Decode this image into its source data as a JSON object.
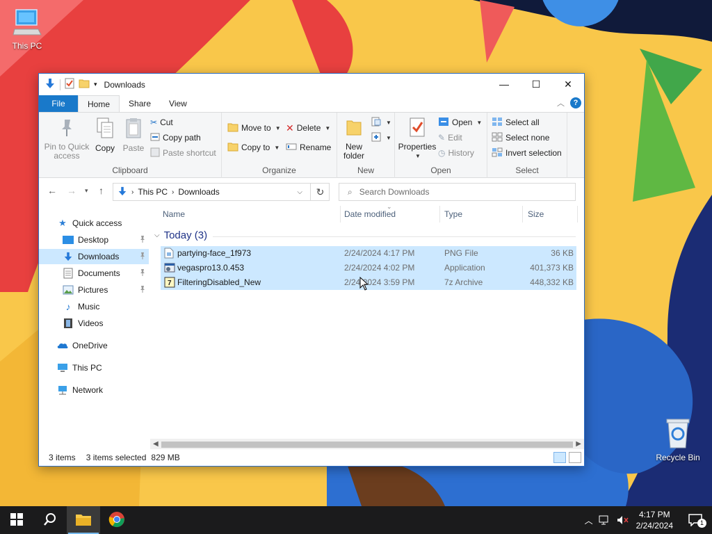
{
  "desktop": {
    "icons": [
      {
        "label": "This PC"
      },
      {
        "label": "Recycle Bin"
      }
    ]
  },
  "window": {
    "title": "Downloads",
    "controls": {
      "minimize": "—",
      "maximize": "☐",
      "close": "✕"
    }
  },
  "ribbon": {
    "tabs": [
      "File",
      "Home",
      "Share",
      "View"
    ],
    "active_tab": "Home",
    "groups": {
      "clipboard": {
        "label": "Clipboard",
        "pin": "Pin to Quick access",
        "copy": "Copy",
        "paste": "Paste",
        "cut": "Cut",
        "copy_path": "Copy path",
        "paste_shortcut": "Paste shortcut"
      },
      "organize": {
        "label": "Organize",
        "move_to": "Move to",
        "copy_to": "Copy to",
        "delete": "Delete",
        "rename": "Rename"
      },
      "new": {
        "label": "New",
        "new_folder": "New folder"
      },
      "open": {
        "label": "Open",
        "properties": "Properties",
        "open": "Open",
        "edit": "Edit",
        "history": "History"
      },
      "select": {
        "label": "Select",
        "select_all": "Select all",
        "select_none": "Select none",
        "invert": "Invert selection"
      }
    }
  },
  "address": {
    "crumbs": [
      "This PC",
      "Downloads"
    ],
    "search_placeholder": "Search Downloads"
  },
  "nav": {
    "quick_access": "Quick access",
    "items": [
      {
        "label": "Desktop",
        "pinned": true
      },
      {
        "label": "Downloads",
        "pinned": true
      },
      {
        "label": "Documents",
        "pinned": true
      },
      {
        "label": "Pictures",
        "pinned": true
      },
      {
        "label": "Music",
        "pinned": false
      },
      {
        "label": "Videos",
        "pinned": false
      }
    ],
    "onedrive": "OneDrive",
    "this_pc": "This PC",
    "network": "Network"
  },
  "files": {
    "columns": [
      "Name",
      "Date modified",
      "Type",
      "Size"
    ],
    "group": "Today (3)",
    "rows": [
      {
        "name": "partying-face_1f973",
        "date": "2/24/2024 4:17 PM",
        "type": "PNG File",
        "size": "36 KB"
      },
      {
        "name": "vegaspro13.0.453",
        "date": "2/24/2024 4:02 PM",
        "type": "Application",
        "size": "401,373 KB"
      },
      {
        "name": "FilteringDisabled_New",
        "date": "2/24/2024 3:59 PM",
        "type": "7z Archive",
        "size": "448,332 KB"
      }
    ]
  },
  "status": {
    "count": "3 items",
    "selected": "3 items selected",
    "size": "829 MB"
  },
  "taskbar": {
    "time": "4:17 PM",
    "date": "2/24/2024",
    "notifications": "1"
  }
}
